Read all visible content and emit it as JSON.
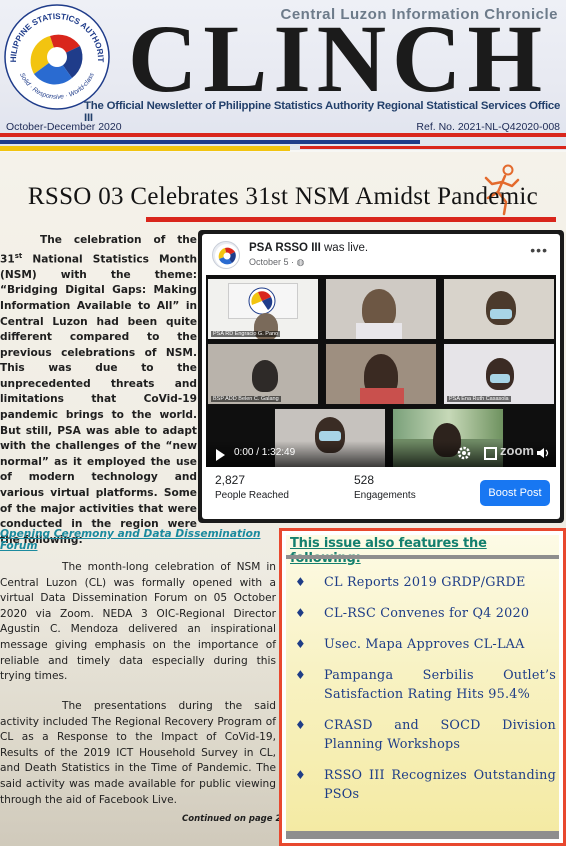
{
  "masthead": {
    "logo_text": "PHILIPPINE STATISTICS AUTHORITY",
    "logo_tagline": "Solid · Responsive · World-class",
    "chronicle": "Central Luzon Information Chronicle",
    "title": "CLINCH",
    "subtitle": "The Official Newsletter of Philippine Statistics Authority Regional Statistical Services Office III",
    "issue_date": "October-December 2020",
    "ref_no": "Ref. No. 2021-NL-Q42020-008",
    "colors": {
      "red": "#d9261c",
      "blue": "#1f3c8a",
      "yellow": "#f2c410"
    }
  },
  "article": {
    "headline": "RSSO 03 Celebrates 31st NSM Amidst Pandemic",
    "p1_a": "The celebration of the 31",
    "p1_sup": "st",
    "p1_b": " National Statistics Month (NSM) with the theme: “Bridging Digital Gaps: Making Information Available to All” in Central Luzon had been quite different compared to the previous celebrations of NSM. This was due to the unprecedented threats and limitations that CoVid-19 pandemic brings to the world. But still, PSA was able to adapt with the challenges of the “new normal” as it employed the use of modern technology and various virtual platforms. Some of the major activities that were conducted in the region were the following:",
    "section_heading": "Opening Ceremony and Data Dissemination Forum",
    "p2": "The month-long celebration of NSM in Central Luzon (CL) was formally opened with a virtual Data Dissemination Forum on 05 October 2020 via Zoom. NEDA 3 OIC-Regional Director Agustin C. Mendoza delivered an inspirational message giving emphasis on the importance of reliable and timely data especially during this trying times.",
    "p3": "The presentations during the said activity included The Regional Recovery Program of CL as a Response to the Impact of CoVid-19, Results of the 2019 ICT Household Survey in CL, and Death Statistics in the Time of Pandemic. The said activity was made available for public viewing through the aid of Facebook Live.",
    "continued": "Continued on page 2"
  },
  "fb_post": {
    "page_name": "PSA RSSO III",
    "action": " was live.",
    "time": "October 5 · ◍",
    "more_icon": "•••",
    "video_time": "0:00 / 1:32:49",
    "zoom_watermark": "zoom",
    "tiles": [
      "PSA RD Engracio G. Pano",
      "",
      "",
      "BSP ADD Belen C. Galang",
      "",
      "PSA Ena Ruth Casasola",
      "",
      ""
    ],
    "people_reached_value": "2,827",
    "people_reached_label": "People Reached",
    "engagements_value": "528",
    "engagements_label": "Engagements",
    "boost_label": "Boost Post",
    "boost_color": "#1877f2"
  },
  "sidebar": {
    "heading": "This issue also features the following:",
    "items": [
      "CL Reports 2019 GRDP/GRDE",
      "CL-RSC Convenes for Q4 2020",
      "Usec. Mapa Approves CL-LAA",
      "Pampanga Serbilis Outlet’s Satisfaction Rating Hits 95.4%",
      "CRASD and SOCD Division Planning Workshops",
      "RSSO III Recognizes Outstanding PSOs"
    ],
    "bullet": "♦"
  }
}
